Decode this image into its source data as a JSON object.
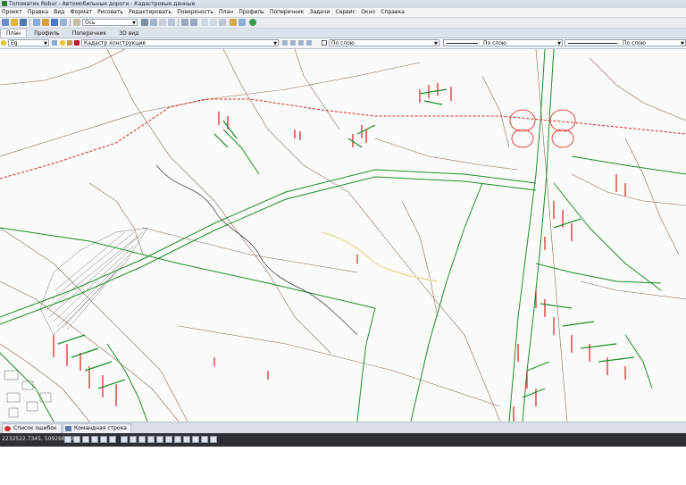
{
  "window": {
    "title": "Топоматик Robur - Автомобильные дороги - Кадастровые данные"
  },
  "menu": [
    "Проект",
    "Правка",
    "Вид",
    "Формат",
    "Рисовать",
    "Редактировать",
    "Поверхность",
    "План",
    "Профиль",
    "Поперечник",
    "Задачи",
    "Сервис",
    "Окно",
    "Справка"
  ],
  "toolbar": {
    "axis_combo": "Ось"
  },
  "view_tabs": [
    "План",
    "Профиль",
    "Поперечник",
    "3D вид"
  ],
  "layer_bar": {
    "layer_combo": "Eg",
    "construction_combo": "Кадастр конструкция",
    "color_combo": "По слою",
    "linetype_combo": "По слою",
    "lineweight_combo": "По слою"
  },
  "bottom_tabs": [
    "Список ошибок",
    "Командная строка"
  ],
  "status": {
    "coords": "2232522.7345, 509266.5970"
  },
  "colors": {
    "road_green": "#1f8a2e",
    "boundary_red": "#d42020",
    "parcel_brown": "#8b6a55",
    "status_dark": "#2c2f33"
  }
}
